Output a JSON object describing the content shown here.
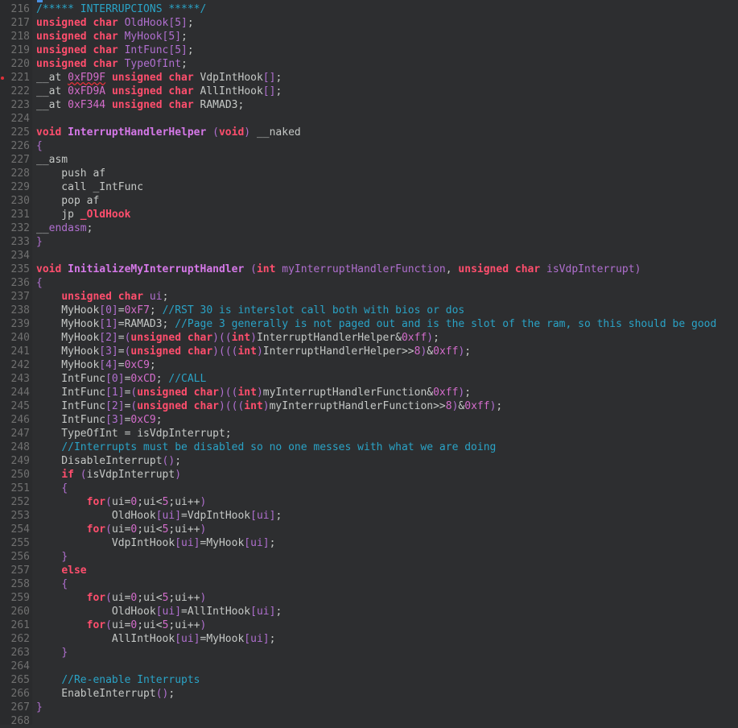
{
  "editor": {
    "breakpoint_line": "221",
    "lines": [
      {
        "n": "216",
        "t": [
          [
            "cm",
            "/***** INTERRUPCIONS *****/"
          ]
        ]
      },
      {
        "n": "217",
        "t": [
          [
            "kw",
            "unsigned"
          ],
          [
            "tx",
            " "
          ],
          [
            "kw",
            "char"
          ],
          [
            "tx",
            " "
          ],
          [
            "pn",
            "OldHook[5]"
          ],
          [
            "tx",
            ";"
          ]
        ]
      },
      {
        "n": "218",
        "t": [
          [
            "kw",
            "unsigned"
          ],
          [
            "tx",
            " "
          ],
          [
            "kw",
            "char"
          ],
          [
            "tx",
            " "
          ],
          [
            "pn",
            "MyHook[5]"
          ],
          [
            "tx",
            ";"
          ]
        ]
      },
      {
        "n": "219",
        "t": [
          [
            "kw",
            "unsigned"
          ],
          [
            "tx",
            " "
          ],
          [
            "kw",
            "char"
          ],
          [
            "tx",
            " "
          ],
          [
            "pn",
            "IntFunc[5]"
          ],
          [
            "tx",
            ";"
          ]
        ]
      },
      {
        "n": "220",
        "t": [
          [
            "kw",
            "unsigned"
          ],
          [
            "tx",
            " "
          ],
          [
            "kw",
            "char"
          ],
          [
            "tx",
            " "
          ],
          [
            "pn",
            "TypeOfInt"
          ],
          [
            "tx",
            ";"
          ]
        ]
      },
      {
        "n": "221",
        "t": [
          [
            "tx",
            "__at "
          ],
          [
            "nm",
            "0xFD9F"
          ],
          [
            "tx",
            " "
          ],
          [
            "kw",
            "unsigned"
          ],
          [
            "tx",
            " "
          ],
          [
            "kw",
            "char"
          ],
          [
            "tx",
            " VdpIntHook"
          ],
          [
            "pn",
            "[]"
          ],
          [
            "tx",
            ";"
          ]
        ]
      },
      {
        "n": "222",
        "t": [
          [
            "tx",
            "__at "
          ],
          [
            "nm",
            "0xFD9A"
          ],
          [
            "tx",
            " "
          ],
          [
            "kw",
            "unsigned"
          ],
          [
            "tx",
            " "
          ],
          [
            "kw",
            "char"
          ],
          [
            "tx",
            " AllIntHook"
          ],
          [
            "pn",
            "[]"
          ],
          [
            "tx",
            ";"
          ]
        ]
      },
      {
        "n": "223",
        "t": [
          [
            "tx",
            "__at "
          ],
          [
            "nm",
            "0xF344"
          ],
          [
            "tx",
            " "
          ],
          [
            "kw",
            "unsigned"
          ],
          [
            "tx",
            " "
          ],
          [
            "kw",
            "char"
          ],
          [
            "tx",
            " RAMAD3;"
          ]
        ]
      },
      {
        "n": "224",
        "t": []
      },
      {
        "n": "225",
        "t": [
          [
            "kw",
            "void"
          ],
          [
            "tx",
            " "
          ],
          [
            "fn",
            "InterruptHandlerHelper"
          ],
          [
            "tx",
            " "
          ],
          [
            "pn",
            "("
          ],
          [
            "kw",
            "void"
          ],
          [
            "pn",
            ")"
          ],
          [
            "tx",
            " __naked"
          ]
        ]
      },
      {
        "n": "226",
        "t": [
          [
            "pn",
            "{"
          ]
        ]
      },
      {
        "n": "227",
        "t": [
          [
            "tx",
            "__asm"
          ]
        ]
      },
      {
        "n": "228",
        "t": [
          [
            "tx",
            "    push af"
          ]
        ]
      },
      {
        "n": "229",
        "t": [
          [
            "tx",
            "    call _IntFunc"
          ]
        ]
      },
      {
        "n": "230",
        "t": [
          [
            "tx",
            "    pop af"
          ]
        ]
      },
      {
        "n": "231",
        "t": [
          [
            "tx",
            "    jp "
          ],
          [
            "kw",
            "_OldHook"
          ]
        ]
      },
      {
        "n": "232",
        "t": [
          [
            "tx",
            "__"
          ],
          [
            "pn",
            "endasm"
          ],
          [
            "tx",
            ";"
          ]
        ]
      },
      {
        "n": "233",
        "t": [
          [
            "pn",
            "}"
          ]
        ]
      },
      {
        "n": "234",
        "t": []
      },
      {
        "n": "235",
        "t": [
          [
            "kw",
            "void"
          ],
          [
            "tx",
            " "
          ],
          [
            "fn",
            "InitializeMyInterruptHandler"
          ],
          [
            "tx",
            " "
          ],
          [
            "pn",
            "("
          ],
          [
            "kw",
            "int"
          ],
          [
            "tx",
            " "
          ],
          [
            "pn",
            "myInterruptHandlerFunction"
          ],
          [
            "tx",
            ", "
          ],
          [
            "kw",
            "unsigned"
          ],
          [
            "tx",
            " "
          ],
          [
            "kw",
            "char"
          ],
          [
            "tx",
            " "
          ],
          [
            "pn",
            "isVdpInterrupt"
          ],
          [
            "pn",
            ")"
          ]
        ]
      },
      {
        "n": "236",
        "t": [
          [
            "pn",
            "{"
          ]
        ]
      },
      {
        "n": "237",
        "t": [
          [
            "tx",
            "    "
          ],
          [
            "kw",
            "unsigned"
          ],
          [
            "tx",
            " "
          ],
          [
            "kw",
            "char"
          ],
          [
            "tx",
            " "
          ],
          [
            "pn",
            "ui"
          ],
          [
            "tx",
            ";"
          ]
        ]
      },
      {
        "n": "238",
        "t": [
          [
            "tx",
            "    MyHook"
          ],
          [
            "pn",
            "[0]"
          ],
          [
            "tx",
            "="
          ],
          [
            "nm",
            "0xF7"
          ],
          [
            "tx",
            "; "
          ],
          [
            "cm",
            "//RST 30 is interslot call both with bios or dos"
          ]
        ]
      },
      {
        "n": "239",
        "t": [
          [
            "tx",
            "    MyHook"
          ],
          [
            "pn",
            "[1]"
          ],
          [
            "tx",
            "=RAMAD3; "
          ],
          [
            "cm",
            "//Page 3 generally is not paged out and is the slot of the ram, so this should be good"
          ]
        ]
      },
      {
        "n": "240",
        "t": [
          [
            "tx",
            "    MyHook"
          ],
          [
            "pn",
            "[2]"
          ],
          [
            "tx",
            "="
          ],
          [
            "pn",
            "("
          ],
          [
            "kw",
            "unsigned char"
          ],
          [
            "pn",
            ")(("
          ],
          [
            "kw",
            "int"
          ],
          [
            "pn",
            ")"
          ],
          [
            "tx",
            "InterruptHandlerHelper&"
          ],
          [
            "nm",
            "0xff"
          ],
          [
            "pn",
            ")"
          ],
          [
            "tx",
            ";"
          ]
        ]
      },
      {
        "n": "241",
        "t": [
          [
            "tx",
            "    MyHook"
          ],
          [
            "pn",
            "[3]"
          ],
          [
            "tx",
            "="
          ],
          [
            "pn",
            "("
          ],
          [
            "kw",
            "unsigned char"
          ],
          [
            "pn",
            ")((("
          ],
          [
            "kw",
            "int"
          ],
          [
            "pn",
            ")"
          ],
          [
            "tx",
            "InterruptHandlerHelper>>"
          ],
          [
            "nm",
            "8"
          ],
          [
            "pn",
            ")"
          ],
          [
            "tx",
            "&"
          ],
          [
            "nm",
            "0xff"
          ],
          [
            "pn",
            ")"
          ],
          [
            "tx",
            ";"
          ]
        ]
      },
      {
        "n": "242",
        "t": [
          [
            "tx",
            "    MyHook"
          ],
          [
            "pn",
            "[4]"
          ],
          [
            "tx",
            "="
          ],
          [
            "nm",
            "0xC9"
          ],
          [
            "tx",
            ";"
          ]
        ]
      },
      {
        "n": "243",
        "t": [
          [
            "tx",
            "    IntFunc"
          ],
          [
            "pn",
            "[0]"
          ],
          [
            "tx",
            "="
          ],
          [
            "nm",
            "0xCD"
          ],
          [
            "tx",
            "; "
          ],
          [
            "cm",
            "//CALL"
          ]
        ]
      },
      {
        "n": "244",
        "t": [
          [
            "tx",
            "    IntFunc"
          ],
          [
            "pn",
            "[1]"
          ],
          [
            "tx",
            "="
          ],
          [
            "pn",
            "("
          ],
          [
            "kw",
            "unsigned char"
          ],
          [
            "pn",
            ")(("
          ],
          [
            "kw",
            "int"
          ],
          [
            "pn",
            ")"
          ],
          [
            "tx",
            "myInterruptHandlerFunction&"
          ],
          [
            "nm",
            "0xff"
          ],
          [
            "pn",
            ")"
          ],
          [
            "tx",
            ";"
          ]
        ]
      },
      {
        "n": "245",
        "t": [
          [
            "tx",
            "    IntFunc"
          ],
          [
            "pn",
            "[2]"
          ],
          [
            "tx",
            "="
          ],
          [
            "pn",
            "("
          ],
          [
            "kw",
            "unsigned char"
          ],
          [
            "pn",
            ")((("
          ],
          [
            "kw",
            "int"
          ],
          [
            "pn",
            ")"
          ],
          [
            "tx",
            "myInterruptHandlerFunction>>"
          ],
          [
            "nm",
            "8"
          ],
          [
            "pn",
            ")"
          ],
          [
            "tx",
            "&"
          ],
          [
            "nm",
            "0xff"
          ],
          [
            "pn",
            ")"
          ],
          [
            "tx",
            ";"
          ]
        ]
      },
      {
        "n": "246",
        "t": [
          [
            "tx",
            "    IntFunc"
          ],
          [
            "pn",
            "[3]"
          ],
          [
            "tx",
            "="
          ],
          [
            "nm",
            "0xC9"
          ],
          [
            "tx",
            ";"
          ]
        ]
      },
      {
        "n": "247",
        "t": [
          [
            "tx",
            "    TypeOfInt = isVdpInterrupt;"
          ]
        ]
      },
      {
        "n": "248",
        "t": [
          [
            "tx",
            "    "
          ],
          [
            "cm",
            "//Interrupts must be disabled so no one messes with what we are doing"
          ]
        ]
      },
      {
        "n": "249",
        "t": [
          [
            "tx",
            "    DisableInterrupt"
          ],
          [
            "pn",
            "()"
          ],
          [
            "tx",
            ";"
          ]
        ]
      },
      {
        "n": "250",
        "t": [
          [
            "tx",
            "    "
          ],
          [
            "kw",
            "if"
          ],
          [
            "tx",
            " "
          ],
          [
            "pn",
            "("
          ],
          [
            "tx",
            "isVdpInterrupt"
          ],
          [
            "pn",
            ")"
          ]
        ]
      },
      {
        "n": "251",
        "t": [
          [
            "tx",
            "    "
          ],
          [
            "pn",
            "{"
          ]
        ]
      },
      {
        "n": "252",
        "t": [
          [
            "tx",
            "        "
          ],
          [
            "kw",
            "for"
          ],
          [
            "pn",
            "("
          ],
          [
            "tx",
            "ui="
          ],
          [
            "nm",
            "0"
          ],
          [
            "tx",
            ";ui<"
          ],
          [
            "nm",
            "5"
          ],
          [
            "tx",
            ";ui++"
          ],
          [
            "pn",
            ")"
          ]
        ]
      },
      {
        "n": "253",
        "t": [
          [
            "tx",
            "            OldHook"
          ],
          [
            "pn",
            "[ui]"
          ],
          [
            "tx",
            "=VdpIntHook"
          ],
          [
            "pn",
            "[ui]"
          ],
          [
            "tx",
            ";"
          ]
        ]
      },
      {
        "n": "254",
        "t": [
          [
            "tx",
            "        "
          ],
          [
            "kw",
            "for"
          ],
          [
            "pn",
            "("
          ],
          [
            "tx",
            "ui="
          ],
          [
            "nm",
            "0"
          ],
          [
            "tx",
            ";ui<"
          ],
          [
            "nm",
            "5"
          ],
          [
            "tx",
            ";ui++"
          ],
          [
            "pn",
            ")"
          ]
        ]
      },
      {
        "n": "255",
        "t": [
          [
            "tx",
            "            VdpIntHook"
          ],
          [
            "pn",
            "[ui]"
          ],
          [
            "tx",
            "=MyHook"
          ],
          [
            "pn",
            "[ui]"
          ],
          [
            "tx",
            ";"
          ]
        ]
      },
      {
        "n": "256",
        "t": [
          [
            "tx",
            "    "
          ],
          [
            "pn",
            "}"
          ]
        ]
      },
      {
        "n": "257",
        "t": [
          [
            "tx",
            "    "
          ],
          [
            "kw",
            "else"
          ]
        ]
      },
      {
        "n": "258",
        "t": [
          [
            "tx",
            "    "
          ],
          [
            "pn",
            "{"
          ]
        ]
      },
      {
        "n": "259",
        "t": [
          [
            "tx",
            "        "
          ],
          [
            "kw",
            "for"
          ],
          [
            "pn",
            "("
          ],
          [
            "tx",
            "ui="
          ],
          [
            "nm",
            "0"
          ],
          [
            "tx",
            ";ui<"
          ],
          [
            "nm",
            "5"
          ],
          [
            "tx",
            ";ui++"
          ],
          [
            "pn",
            ")"
          ]
        ]
      },
      {
        "n": "260",
        "t": [
          [
            "tx",
            "            OldHook"
          ],
          [
            "pn",
            "[ui]"
          ],
          [
            "tx",
            "=AllIntHook"
          ],
          [
            "pn",
            "[ui]"
          ],
          [
            "tx",
            ";"
          ]
        ]
      },
      {
        "n": "261",
        "t": [
          [
            "tx",
            "        "
          ],
          [
            "kw",
            "for"
          ],
          [
            "pn",
            "("
          ],
          [
            "tx",
            "ui="
          ],
          [
            "nm",
            "0"
          ],
          [
            "tx",
            ";ui<"
          ],
          [
            "nm",
            "5"
          ],
          [
            "tx",
            ";ui++"
          ],
          [
            "pn",
            ")"
          ]
        ]
      },
      {
        "n": "262",
        "t": [
          [
            "tx",
            "            AllIntHook"
          ],
          [
            "pn",
            "[ui]"
          ],
          [
            "tx",
            "=MyHook"
          ],
          [
            "pn",
            "[ui]"
          ],
          [
            "tx",
            ";"
          ]
        ]
      },
      {
        "n": "263",
        "t": [
          [
            "tx",
            "    "
          ],
          [
            "pn",
            "}"
          ]
        ]
      },
      {
        "n": "264",
        "t": []
      },
      {
        "n": "265",
        "t": [
          [
            "tx",
            "    "
          ],
          [
            "cm",
            "//Re-enable Interrupts"
          ]
        ]
      },
      {
        "n": "266",
        "t": [
          [
            "tx",
            "    EnableInterrupt"
          ],
          [
            "pn",
            "()"
          ],
          [
            "tx",
            ";"
          ]
        ]
      },
      {
        "n": "267",
        "t": [
          [
            "pn",
            "}"
          ]
        ]
      },
      {
        "n": "268",
        "t": []
      }
    ]
  }
}
